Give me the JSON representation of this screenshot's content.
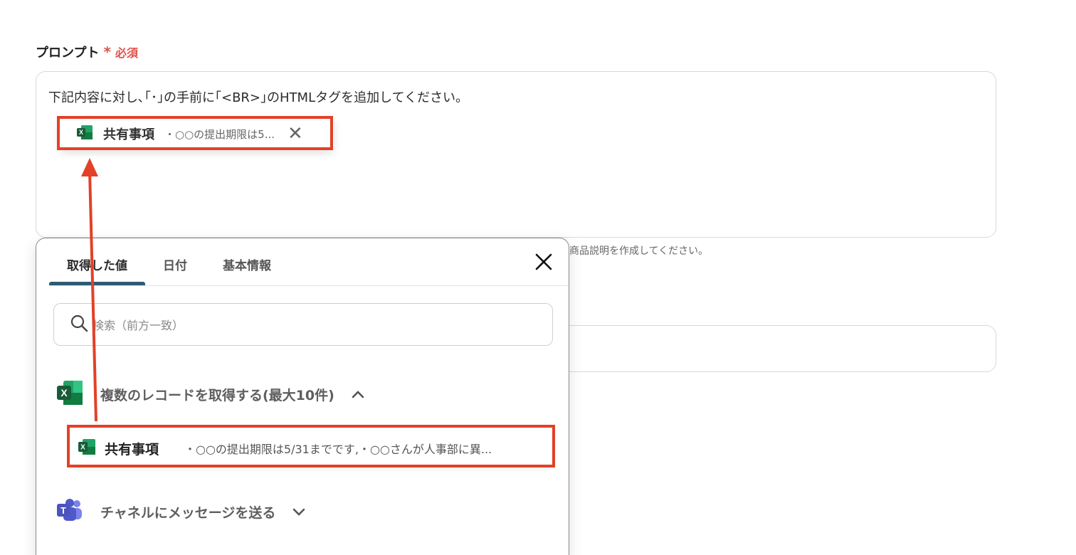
{
  "prompt_field": {
    "label": "プロンプト",
    "required_mark": "*",
    "required_text": "必須",
    "text": "下記内容に対し､｢･｣の手前に｢<BR>｣のHTMLタグを追加してください。",
    "chip": {
      "title": "共有事項",
      "value": "・○○の提出期限は5...",
      "close": "✕",
      "icon": "excel-icon"
    }
  },
  "hint": "商品説明を作成してください。",
  "popup": {
    "tabs": [
      "取得した値",
      "日付",
      "基本情報"
    ],
    "active_tab": "取得した値",
    "close": "✕",
    "search_placeholder": "検索（前方一致）",
    "groups": [
      {
        "label": "複数のレコードを取得する(最大10件)",
        "icon": "excel-icon",
        "chevron": "up"
      },
      {
        "label": "チャネルにメッセージを送る",
        "icon": "teams-icon",
        "chevron": "down"
      }
    ],
    "result": {
      "title": "共有事項",
      "value": "・○○の提出期限は5/31までです,・○○さんが人事部に異...",
      "icon": "excel-icon"
    }
  },
  "colors": {
    "highlight": "#e24127",
    "required": "#e0524a",
    "tab_underline": "#2e5b73",
    "excel_green": "#1f7244",
    "teams_purple": "#5558af"
  }
}
